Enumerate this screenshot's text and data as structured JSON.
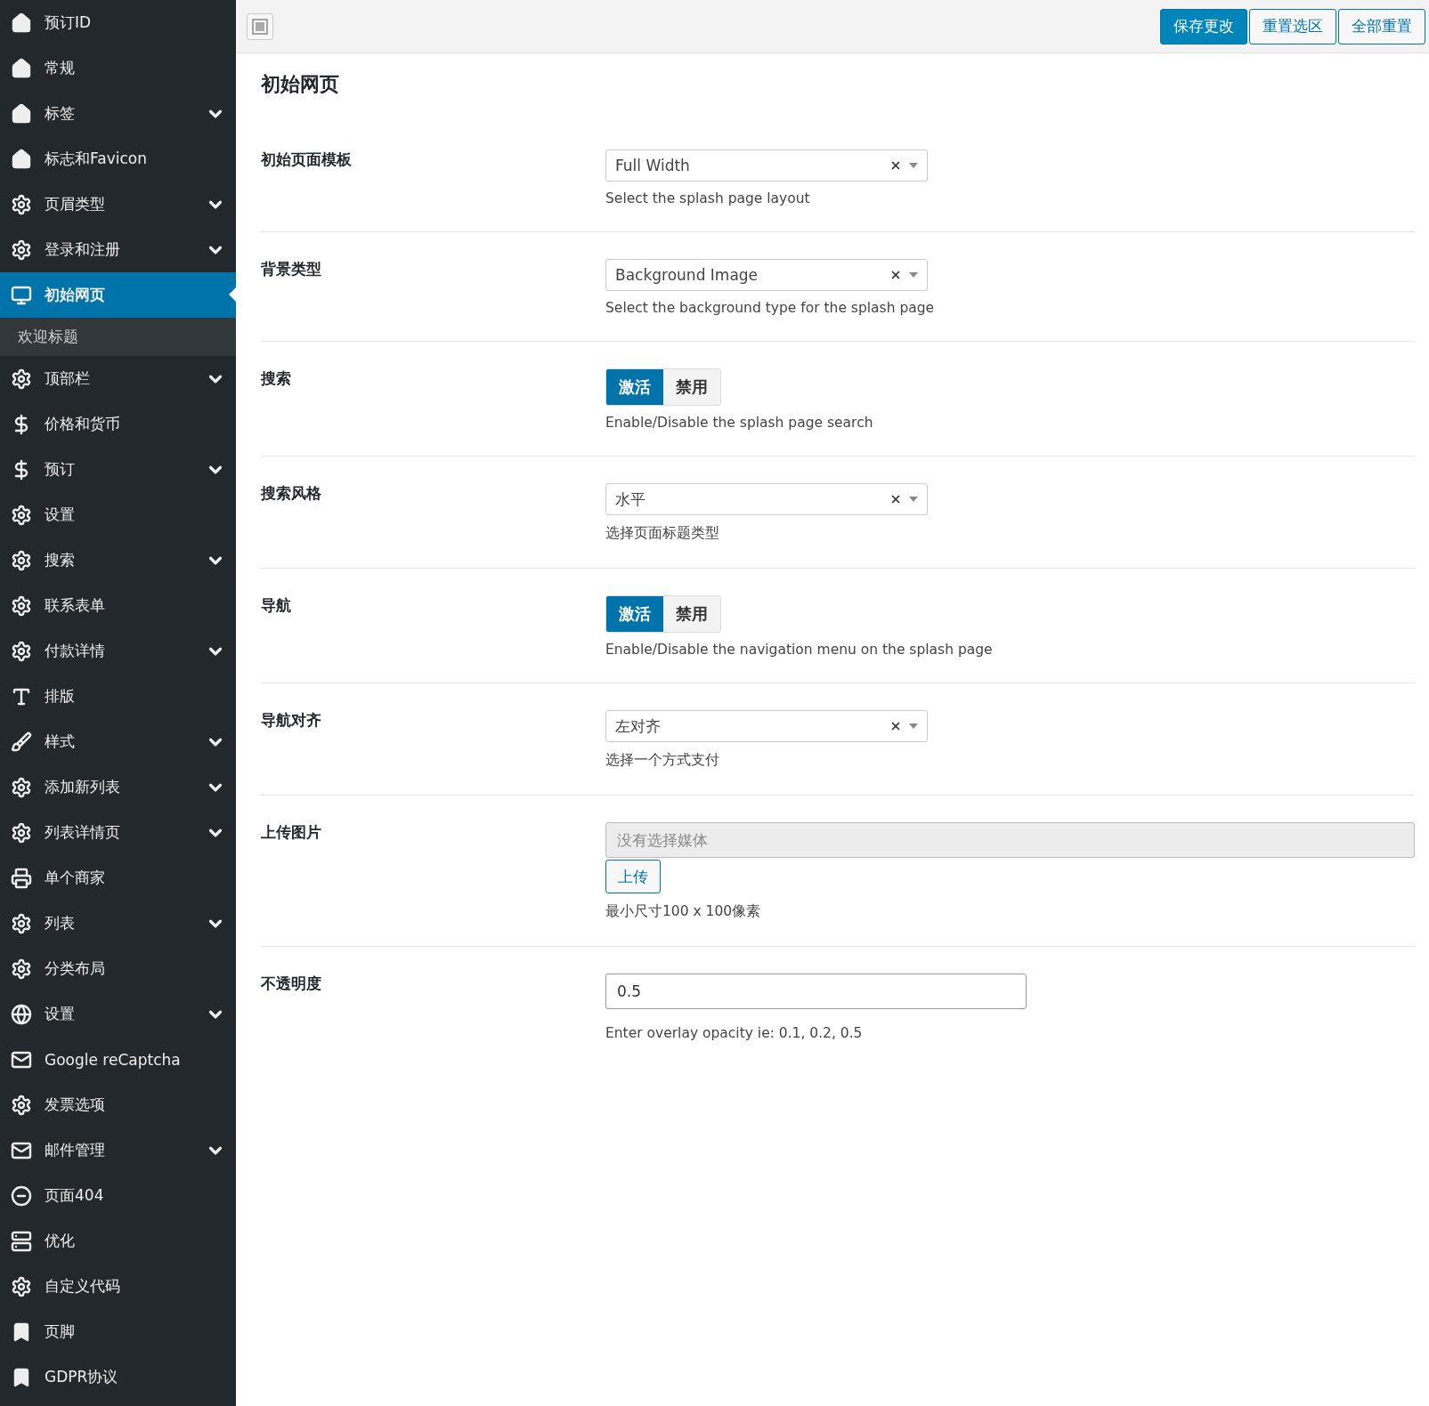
{
  "sidebar": {
    "items": [
      {
        "label": "预订ID",
        "kind": "home",
        "expandable": false,
        "selected": false
      },
      {
        "label": "常规",
        "kind": "home",
        "expandable": false,
        "selected": false
      },
      {
        "label": "标签",
        "kind": "home",
        "expandable": true,
        "selected": false
      },
      {
        "label": "标志和Favicon",
        "kind": "home",
        "expandable": false,
        "selected": false
      },
      {
        "label": "页眉类型",
        "kind": "gear",
        "expandable": true,
        "selected": false
      },
      {
        "label": "登录和注册",
        "kind": "gear",
        "expandable": true,
        "selected": false
      },
      {
        "label": "初始网页",
        "kind": "monitor",
        "expandable": false,
        "selected": true,
        "children": [
          {
            "label": "欢迎标题"
          }
        ]
      },
      {
        "label": "顶部栏",
        "kind": "gear",
        "expandable": true,
        "selected": false
      },
      {
        "label": "价格和货币",
        "kind": "dollar",
        "expandable": false,
        "selected": false
      },
      {
        "label": "预订",
        "kind": "dollar",
        "expandable": true,
        "selected": false
      },
      {
        "label": "设置",
        "kind": "gear",
        "expandable": false,
        "selected": false
      },
      {
        "label": "搜索",
        "kind": "gear",
        "expandable": true,
        "selected": false
      },
      {
        "label": "联系表单",
        "kind": "gear",
        "expandable": false,
        "selected": false
      },
      {
        "label": "付款详情",
        "kind": "gear",
        "expandable": true,
        "selected": false
      },
      {
        "label": "排版",
        "kind": "font",
        "expandable": false,
        "selected": false
      },
      {
        "label": "样式",
        "kind": "brush",
        "expandable": true,
        "selected": false
      },
      {
        "label": "添加新列表",
        "kind": "gear",
        "expandable": true,
        "selected": false
      },
      {
        "label": "列表详情页",
        "kind": "gear",
        "expandable": true,
        "selected": false
      },
      {
        "label": "单个商家",
        "kind": "print",
        "expandable": false,
        "selected": false
      },
      {
        "label": "列表",
        "kind": "gear",
        "expandable": true,
        "selected": false
      },
      {
        "label": "分类布局",
        "kind": "gear",
        "expandable": false,
        "selected": false
      },
      {
        "label": "设置",
        "kind": "globe",
        "expandable": true,
        "selected": false
      },
      {
        "label": "Google reCaptcha",
        "kind": "mail",
        "expandable": false,
        "selected": false
      },
      {
        "label": "发票选项",
        "kind": "gear",
        "expandable": false,
        "selected": false
      },
      {
        "label": "邮件管理",
        "kind": "mail",
        "expandable": true,
        "selected": false
      },
      {
        "label": "页面404",
        "kind": "minus",
        "expandable": false,
        "selected": false
      },
      {
        "label": "优化",
        "kind": "server",
        "expandable": false,
        "selected": false
      },
      {
        "label": "自定义代码",
        "kind": "gear",
        "expandable": false,
        "selected": false
      },
      {
        "label": "页脚",
        "kind": "bookmark",
        "expandable": false,
        "selected": false
      },
      {
        "label": "GDPR协议",
        "kind": "bookmark",
        "expandable": false,
        "selected": false
      }
    ]
  },
  "toolbar": {
    "buttons": [
      {
        "label": "保存更改",
        "primary": true
      },
      {
        "label": "重置选区",
        "primary": false
      },
      {
        "label": "全部重置",
        "primary": false
      }
    ]
  },
  "section_title": "初始网页",
  "fields": [
    {
      "kind": "select",
      "label": "初始页面模板",
      "value": "Full Width",
      "description": "Select the splash page layout"
    },
    {
      "kind": "select",
      "label": "背景类型",
      "value": "Background Image",
      "description": "Select the background type for the splash page"
    },
    {
      "kind": "toggle",
      "label": "搜索",
      "options": [
        {
          "label": "激活",
          "selected": true
        },
        {
          "label": "禁用",
          "selected": false
        }
      ],
      "description": "Enable/Disable the splash page search"
    },
    {
      "kind": "select",
      "label": "搜索风格",
      "value": "水平",
      "description": "选择页面标题类型"
    },
    {
      "kind": "toggle",
      "label": "导航",
      "options": [
        {
          "label": "激活",
          "selected": true
        },
        {
          "label": "禁用",
          "selected": false
        }
      ],
      "description": "Enable/Disable the navigation menu on the splash page"
    },
    {
      "kind": "select",
      "label": "导航对齐",
      "value": "左对齐",
      "description": "选择一个方式支付"
    },
    {
      "kind": "media",
      "label": "上传图片",
      "placeholder": "没有选择媒体",
      "button": "上传",
      "description": "最小尺寸100 x 100像素"
    },
    {
      "kind": "text",
      "label": "不透明度",
      "value": "0.5",
      "description": "Enter overlay opacity ie: 0.1, 0.2, 0.5"
    }
  ]
}
